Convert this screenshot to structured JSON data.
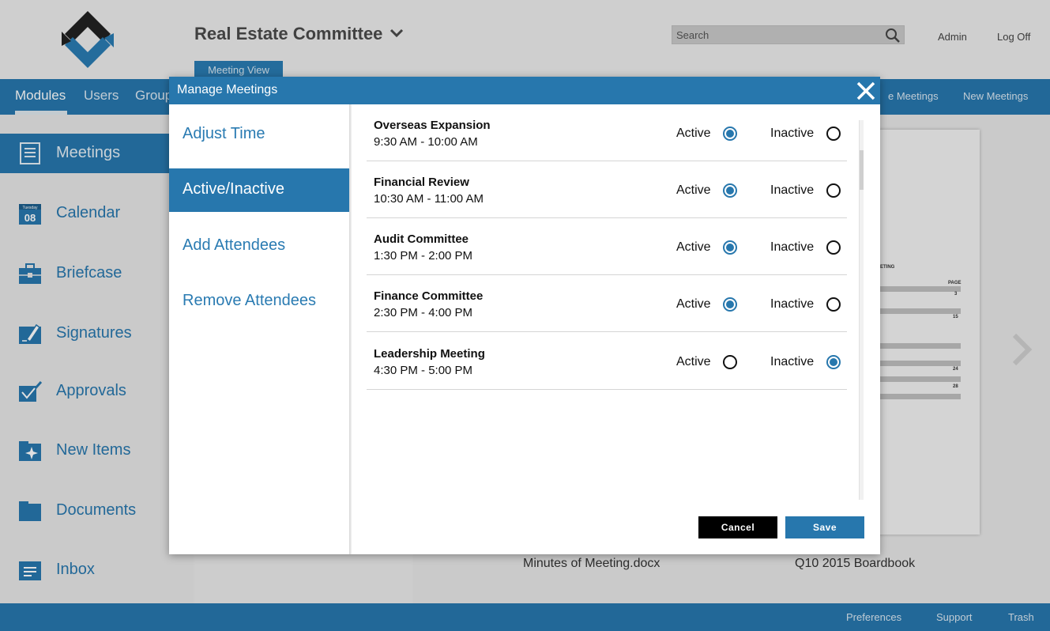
{
  "app": {
    "title": "Real Estate Committee",
    "view_tab": "Meeting View",
    "search_placeholder": "Search",
    "admin": "Admin",
    "logoff": "Log Off"
  },
  "nav": {
    "items": [
      "Modules",
      "Users",
      "Group"
    ],
    "right_items": [
      "e Meetings",
      "New Meetings"
    ]
  },
  "sidebar": {
    "items": [
      {
        "label": "Meetings",
        "icon": "meetings-icon"
      },
      {
        "label": "Calendar",
        "icon": "calendar-icon",
        "day": "Tuesday",
        "date": "08"
      },
      {
        "label": "Briefcase",
        "icon": "briefcase-icon"
      },
      {
        "label": "Signatures",
        "icon": "signature-icon"
      },
      {
        "label": "Approvals",
        "icon": "approvals-icon"
      },
      {
        "label": "New Items",
        "icon": "new-items-icon"
      },
      {
        "label": "Documents",
        "icon": "folder-icon"
      },
      {
        "label": "Inbox",
        "icon": "inbox-icon"
      }
    ]
  },
  "files": [
    "Minutes of Meeting.docx",
    "Q10 2015 Boardbook"
  ],
  "doc_preview": {
    "heading": "ETING",
    "page_label": "PAGE",
    "pages": [
      "3",
      "15",
      "24",
      "28"
    ]
  },
  "footer": {
    "links": [
      "Preferences",
      "Support",
      "Trash"
    ]
  },
  "modal": {
    "title": "Manage Meetings",
    "menu": [
      "Adjust Time",
      "Active/Inactive",
      "Add Attendees",
      "Remove Attendees"
    ],
    "active_menu_index": 1,
    "active_label": "Active",
    "inactive_label": "Inactive",
    "meetings": [
      {
        "name": "Overseas Expansion",
        "time": "9:30 AM - 10:00 AM",
        "status": "active"
      },
      {
        "name": "Financial Review",
        "time": "10:30 AM - 11:00 AM",
        "status": "active"
      },
      {
        "name": "Audit Committee",
        "time": "1:30 PM - 2:00 PM",
        "status": "active"
      },
      {
        "name": "Finance Committee",
        "time": "2:30 PM - 4:00 PM",
        "status": "active"
      },
      {
        "name": "Leadership Meeting",
        "time": "4:30 PM - 5:00 PM",
        "status": "inactive"
      }
    ],
    "cancel_label": "Cancel",
    "save_label": "Save"
  },
  "colors": {
    "accent": "#2777ad",
    "background": "#e9e9e9"
  }
}
